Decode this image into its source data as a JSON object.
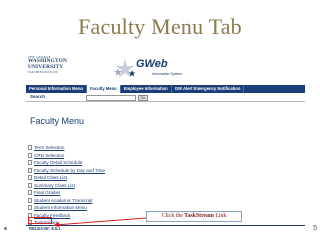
{
  "slide": {
    "title": "Faculty Menu Tab",
    "page_number": "5"
  },
  "header": {
    "university_logo": {
      "line1": "THE GEORGE",
      "line2": "WASHINGTON",
      "line3": "UNIVERSITY",
      "line4": "WASHINGTON DC"
    },
    "app_brand": "GWeb",
    "app_subtitle": "Information System"
  },
  "tabs": [
    {
      "label": "Personal Information Menu",
      "active": false
    },
    {
      "label": "Faculty Menu",
      "active": true
    },
    {
      "label": "Employee Information",
      "active": false
    },
    {
      "label": "GW Alert Emergency Notification",
      "active": false
    }
  ],
  "search": {
    "label": "Search",
    "value": "",
    "go_label": "Go"
  },
  "page": {
    "title": "Faculty Menu"
  },
  "menu_items": [
    "Term Selection",
    "CRN Selection",
    "Faculty Detail Schedule",
    "Faculty Schedule by Day and Time",
    "Detail Class List",
    "Summary Class List",
    "Final Grades",
    "Student Academic Transcript",
    "Student Information Menu",
    "Faculty Feedback",
    "TaskStream"
  ],
  "footer": {
    "release": "RELEASE: 8.5.1"
  },
  "callout": {
    "prefix": "Click the",
    "emphasis": "TaskStream",
    "suffix": "Link"
  },
  "colors": {
    "title_gold": "#8a7a4e",
    "navy": "#1a3e78",
    "highlight_red": "#d22222"
  }
}
